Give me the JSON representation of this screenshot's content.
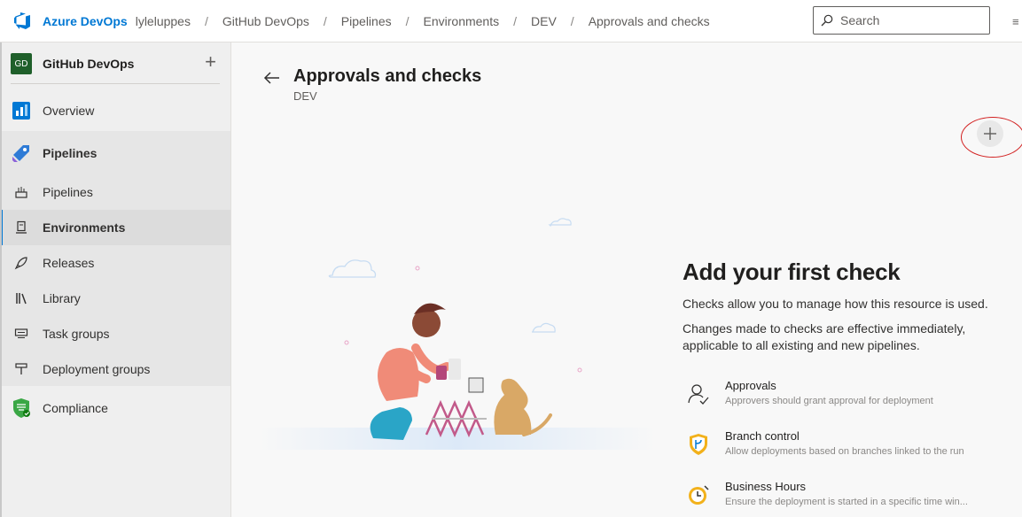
{
  "topbar": {
    "brand": "Azure DevOps",
    "breadcrumbs": [
      "lyleluppes",
      "GitHub DevOps",
      "Pipelines",
      "Environments",
      "DEV",
      "Approvals and checks"
    ],
    "search_placeholder": "Search"
  },
  "sidebar": {
    "project_initials": "GD",
    "project_name": "GitHub DevOps",
    "items": [
      {
        "label": "Overview"
      },
      {
        "label": "Pipelines"
      },
      {
        "label": "Pipelines"
      },
      {
        "label": "Environments"
      },
      {
        "label": "Releases"
      },
      {
        "label": "Library"
      },
      {
        "label": "Task groups"
      },
      {
        "label": "Deployment groups"
      },
      {
        "label": "Compliance"
      }
    ]
  },
  "main": {
    "title": "Approvals and checks",
    "subtitle": "DEV",
    "empty_title": "Add your first check",
    "empty_p1": "Checks allow you to manage how this resource is used.",
    "empty_p2": "Changes made to checks are effective immediately, applicable to all existing and new pipelines.",
    "checks": [
      {
        "name": "Approvals",
        "desc": "Approvers should grant approval for deployment"
      },
      {
        "name": "Branch control",
        "desc": "Allow deployments based on branches linked to the run"
      },
      {
        "name": "Business Hours",
        "desc": "Ensure the deployment is started in a specific time win..."
      }
    ]
  },
  "colors": {
    "accent": "#0078d4",
    "highlight_circle": "#d21f1f",
    "project_badge": "#1f5f2a"
  }
}
